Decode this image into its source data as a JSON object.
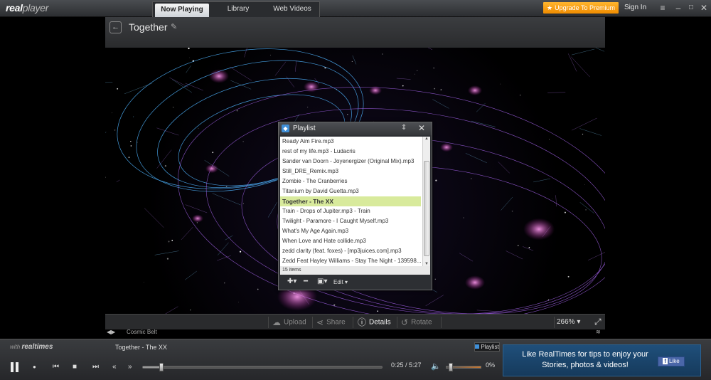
{
  "app": {
    "logo_real": "real",
    "logo_player": "player",
    "tabs": [
      {
        "label": "Now Playing",
        "active": true
      },
      {
        "label": "Library",
        "active": false
      },
      {
        "label": "Web Videos",
        "active": false
      }
    ],
    "upgrade_label": "Upgrade To Premium",
    "signin_label": "Sign In",
    "window_controls": {
      "menu": "≡",
      "minimize": "–",
      "maximize": "□",
      "close": "✕"
    }
  },
  "video": {
    "title": "Together",
    "back_icon": "arrow-left-icon",
    "edit_icon": "pencil-icon",
    "visualization": "Cosmic Belt"
  },
  "playlist": {
    "title": "Playlist",
    "items": [
      "Ready Aim Fire.mp3",
      "rest of my life.mp3 - Ludacris",
      "Sander van Doorn - Joyenergizer (Original Mix).mp3",
      "Still_DRE_Remix.mp3",
      "Zombie - The Cranberries",
      "Titanium by David Guetta.mp3",
      "Together - The XX",
      "Train - Drops of Jupiter.mp3 - Train",
      "Twilight - Paramore - I Caught Myself.mp3",
      "What's My Age Again.mp3",
      "When Love and Hate collide.mp3",
      "zedd clarity (feat. foxes) - [mp3juices.com].mp3",
      "Zedd Feat Hayley Williams - Stay The Night - 139598..."
    ],
    "active_index": 6,
    "count_label": "15 items",
    "edit_label": "Edit"
  },
  "toolbar": {
    "upload_label": "Upload",
    "share_label": "Share",
    "details_label": "Details",
    "rotate_label": "Rotate",
    "zoom_label": "266%"
  },
  "transport": {
    "with_label": "with",
    "realtimes_label": "realtimes",
    "now_playing": "Together - The XX",
    "playlist_toggle": "Playlist",
    "time_label": "0:25 / 5:27",
    "progress_fraction": 0.077,
    "volume_label": "0%",
    "volume_fraction": 0.0
  },
  "promo": {
    "text": "Like RealTimes for tips to enjoy your Stories, photos & videos!",
    "like_label": "Like",
    "fb_letter": "f"
  },
  "colors": {
    "accent_orange": "#f08c00",
    "highlight_row": "#d8ea9c",
    "promo_blue": "#1f4f7a",
    "fb_blue": "#4a66a8"
  }
}
